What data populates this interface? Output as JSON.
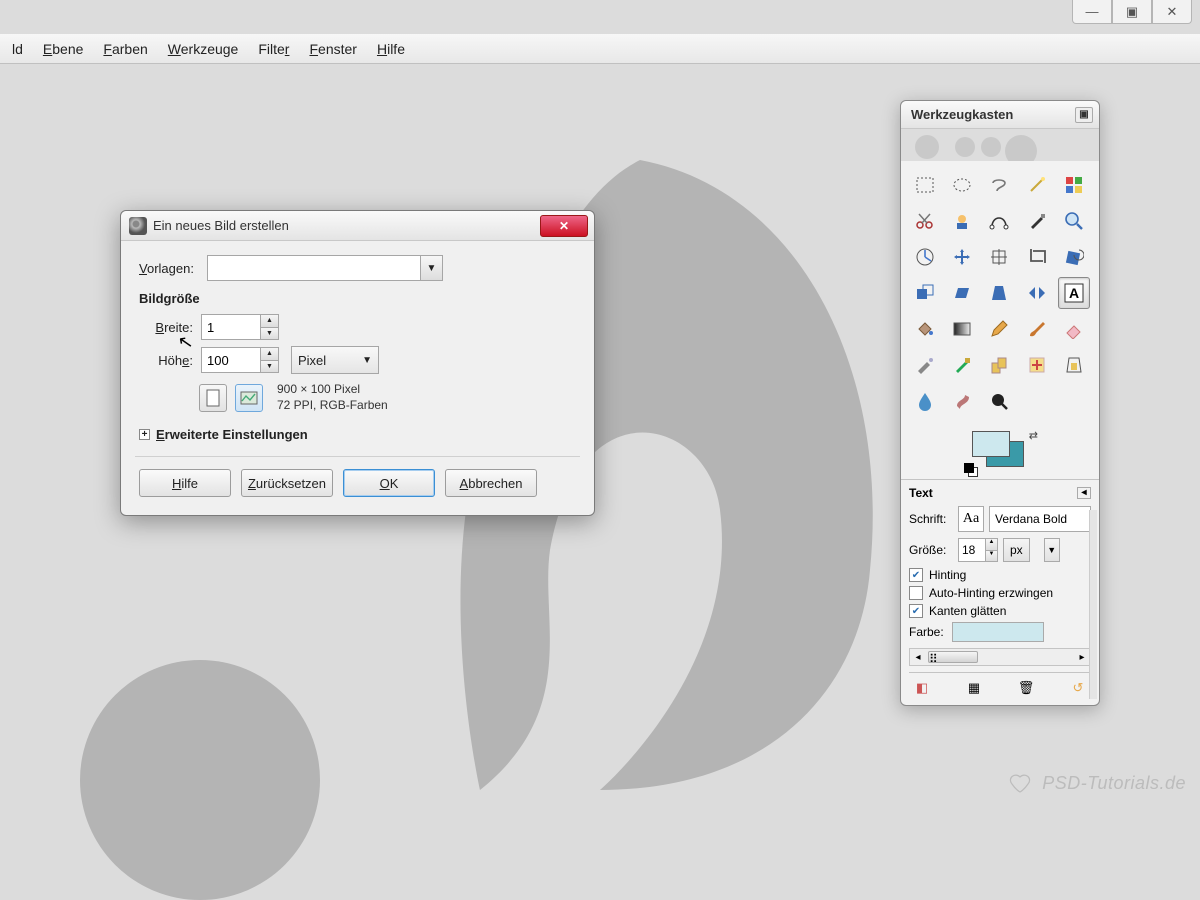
{
  "window_controls": {
    "min": "—",
    "max": "▣",
    "close": "✕"
  },
  "menubar": [
    "ld",
    "Ebene",
    "Farben",
    "Werkzeuge",
    "Filter",
    "Fenster",
    "Hilfe"
  ],
  "dialog": {
    "title": "Ein neues Bild erstellen",
    "close_glyph": "✕",
    "templates_label": "Vorlagen:",
    "section_size": "Bildgröße",
    "width_label": "Breite:",
    "width_value": "1",
    "height_label": "Höhe:",
    "height_value": "100",
    "unit": "Pixel",
    "info_line1": "900 × 100 Pixel",
    "info_line2": "72 PPI, RGB-Farben",
    "expander": "Erweiterte Einstellungen",
    "buttons": {
      "help": "Hilfe",
      "reset": "Zurücksetzen",
      "ok": "OK",
      "cancel": "Abbrechen"
    }
  },
  "toolbox": {
    "title": "Werkzeugkasten",
    "text": {
      "title": "Text",
      "font_label": "Schrift:",
      "font_value": "Verdana Bold",
      "size_label": "Größe:",
      "size_value": "18",
      "size_unit": "px",
      "hinting": "Hinting",
      "autohint": "Auto-Hinting erzwingen",
      "antialias": "Kanten glätten",
      "color_label": "Farbe:"
    }
  },
  "watermark": "PSD-Tutorials.de"
}
